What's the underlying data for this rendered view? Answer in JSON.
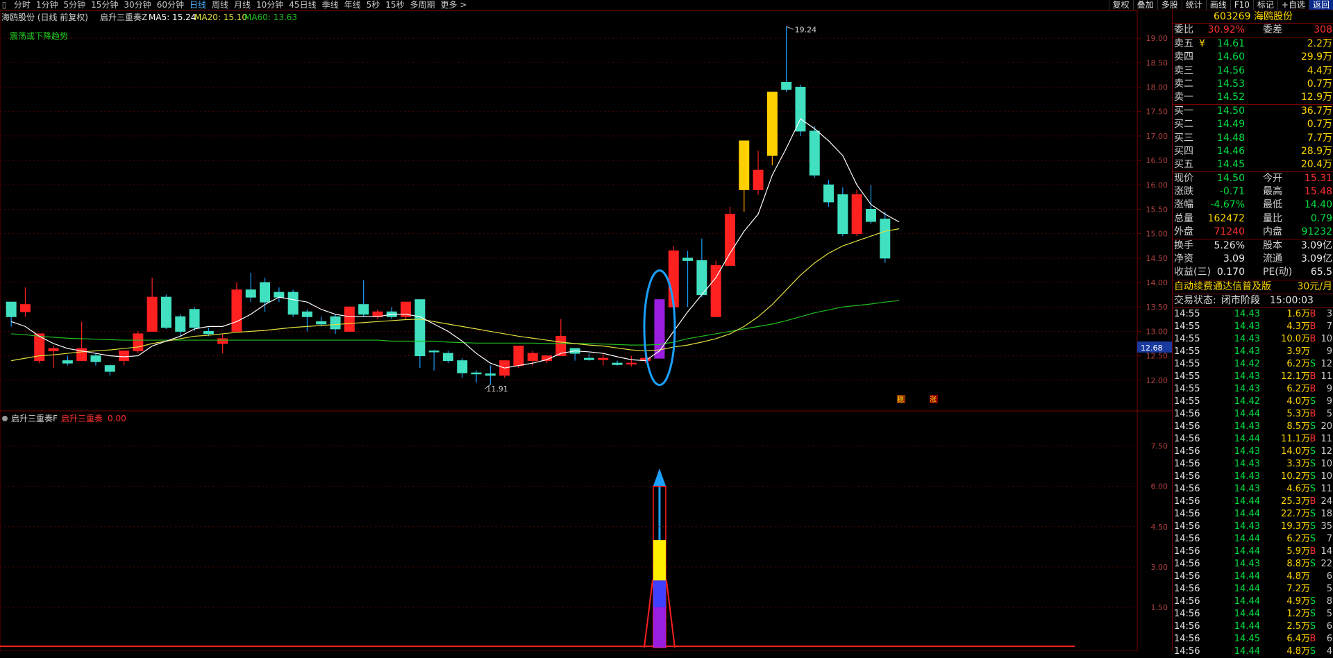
{
  "toolbar": {
    "menu_glyph": "▯",
    "tabs": [
      "分时",
      "1分钟",
      "5分钟",
      "15分钟",
      "30分钟",
      "60分钟",
      "日线",
      "周线",
      "月线",
      "10分钟",
      "45日线",
      "季线",
      "年线",
      "5秒",
      "15秒",
      "多周期",
      "更多 >"
    ],
    "active_tab": "日线",
    "right_buttons": [
      "复权",
      "叠加",
      "多股",
      "统计",
      "画线",
      "F10",
      "标记",
      "+自选",
      "返回"
    ]
  },
  "main_chart": {
    "title": "海鸥股份 (日线 前复权)",
    "indicator_name": "启升三重奏Z",
    "ma5_label": "MA5: 15.24",
    "ma20_label": "MA20: 15.10",
    "ma60_label": "MA60: 13.63",
    "note": "震荡或下降趋势",
    "high_label": "19.24",
    "low_label": "11.91",
    "current_price_tag": "12.68",
    "marker_1": "稳",
    "marker_2": "涨",
    "colors": {
      "up": "#ff2020",
      "down": "#40e0c0",
      "ma5": "#ffffff",
      "ma20": "#e0e040",
      "ma60": "#20c020",
      "highlight": "#9a1ee0",
      "ellipse": "#1aa0ff"
    }
  },
  "sub_chart": {
    "indicator_name": "启升三重奏F",
    "series_label": "启升三重奏",
    "series_value": "0.00"
  },
  "chart_data": {
    "type": "candlestick",
    "y_axis_ticks": [
      "12.00",
      "12.50",
      "13.00",
      "13.50",
      "14.00",
      "14.50",
      "15.00",
      "15.50",
      "16.00",
      "16.50",
      "17.00",
      "17.50",
      "18.00",
      "18.50",
      "19.00"
    ],
    "ylim": [
      11.4,
      19.5
    ],
    "sub_y_ticks": [
      "1.50",
      "3.00",
      "4.50",
      "6.00",
      "7.50"
    ],
    "sub_ylim": [
      0,
      8.6
    ],
    "candles": [
      [
        13.6,
        13.3,
        13.6,
        13.1
      ],
      [
        13.4,
        13.55,
        13.9,
        13.3
      ],
      [
        12.4,
        12.95,
        12.95,
        12.35
      ],
      [
        12.6,
        12.65,
        12.7,
        12.25
      ],
      [
        12.4,
        12.35,
        12.5,
        12.3
      ],
      [
        12.4,
        12.65,
        13.2,
        12.4
      ],
      [
        12.5,
        12.38,
        12.55,
        12.3
      ],
      [
        12.3,
        12.18,
        12.32,
        12.1
      ],
      [
        12.4,
        12.6,
        12.6,
        12.3
      ],
      [
        12.6,
        12.95,
        13.0,
        12.55
      ],
      [
        13.0,
        13.7,
        14.1,
        13.0
      ],
      [
        13.7,
        13.08,
        13.75,
        13.05
      ],
      [
        13.3,
        13.0,
        13.35,
        12.9
      ],
      [
        13.45,
        13.08,
        13.5,
        13.0
      ],
      [
        13.0,
        12.95,
        13.08,
        12.9
      ],
      [
        12.75,
        12.85,
        12.95,
        12.55
      ],
      [
        13.0,
        13.85,
        14.0,
        13.0
      ],
      [
        13.85,
        13.7,
        14.2,
        13.6
      ],
      [
        14.0,
        13.6,
        14.1,
        13.4
      ],
      [
        13.8,
        13.7,
        13.9,
        13.6
      ],
      [
        13.8,
        13.35,
        13.85,
        13.3
      ],
      [
        13.4,
        13.3,
        13.45,
        13.0
      ],
      [
        13.2,
        13.15,
        13.3,
        13.1
      ],
      [
        13.3,
        13.05,
        13.35,
        12.95
      ],
      [
        13.0,
        13.5,
        13.5,
        13.0
      ],
      [
        13.55,
        13.35,
        14.05,
        13.3
      ],
      [
        13.3,
        13.4,
        13.45,
        13.25
      ],
      [
        13.4,
        13.3,
        13.5,
        13.25
      ],
      [
        13.3,
        13.6,
        13.6,
        13.25
      ],
      [
        13.65,
        12.5,
        13.65,
        12.25
      ],
      [
        12.6,
        12.58,
        12.62,
        12.2
      ],
      [
        12.55,
        12.4,
        12.6,
        12.35
      ],
      [
        12.4,
        12.15,
        12.45,
        12.05
      ],
      [
        12.15,
        12.13,
        12.2,
        11.95
      ],
      [
        12.13,
        12.1,
        12.3,
        11.91
      ],
      [
        12.1,
        12.4,
        12.4,
        12.05
      ],
      [
        12.3,
        12.7,
        12.7,
        12.25
      ],
      [
        12.4,
        12.55,
        12.6,
        12.3
      ],
      [
        12.4,
        12.5,
        12.5,
        12.35
      ],
      [
        12.5,
        12.9,
        13.25,
        12.5
      ],
      [
        12.65,
        12.55,
        12.65,
        12.4
      ],
      [
        12.45,
        12.42,
        12.55,
        12.4
      ],
      [
        12.42,
        12.45,
        12.55,
        12.3
      ],
      [
        12.35,
        12.32,
        12.4,
        12.3
      ],
      [
        12.33,
        12.35,
        12.5,
        12.28
      ],
      [
        12.4,
        12.45,
        12.5,
        12.35
      ],
      [
        12.45,
        13.65,
        13.65,
        12.45
      ],
      [
        13.5,
        14.65,
        14.75,
        13.45
      ],
      [
        14.5,
        14.45,
        14.65,
        13.5
      ],
      [
        14.45,
        13.75,
        14.9,
        13.7
      ],
      [
        13.3,
        14.35,
        14.45,
        13.3
      ],
      [
        14.35,
        15.4,
        15.55,
        14.35
      ],
      [
        15.9,
        16.9,
        16.9,
        15.45
      ],
      [
        15.9,
        16.3,
        16.7,
        15.8
      ],
      [
        16.6,
        17.9,
        17.9,
        16.4
      ],
      [
        18.1,
        17.95,
        19.24,
        17.9
      ],
      [
        18.0,
        17.1,
        18.05,
        17.0
      ],
      [
        17.1,
        16.2,
        17.2,
        16.15
      ],
      [
        16.0,
        15.65,
        16.1,
        15.55
      ],
      [
        15.8,
        15.0,
        15.95,
        14.95
      ],
      [
        15.0,
        15.8,
        15.9,
        14.95
      ],
      [
        15.5,
        15.25,
        16.0,
        15.2
      ],
      [
        15.3,
        14.5,
        15.45,
        14.4
      ]
    ],
    "ma5": [
      13.2,
      13.1,
      12.9,
      12.75,
      12.65,
      12.6,
      12.55,
      12.5,
      12.48,
      12.5,
      12.7,
      12.8,
      12.9,
      13.05,
      13.1,
      13.1,
      13.2,
      13.35,
      13.55,
      13.7,
      13.65,
      13.6,
      13.45,
      13.35,
      13.3,
      13.3,
      13.3,
      13.35,
      13.35,
      13.3,
      13.15,
      13.0,
      12.8,
      12.55,
      12.35,
      12.25,
      12.3,
      12.35,
      12.42,
      12.55,
      12.6,
      12.58,
      12.55,
      12.48,
      12.42,
      12.4,
      12.6,
      13.0,
      13.4,
      13.75,
      14.1,
      14.6,
      15.05,
      15.4,
      16.2,
      16.75,
      17.35,
      17.15,
      16.9,
      16.6,
      16.0,
      15.6,
      15.4,
      15.24
    ],
    "ma20": [
      12.4,
      12.45,
      12.5,
      12.52,
      12.55,
      12.58,
      12.6,
      12.62,
      12.65,
      12.68,
      12.75,
      12.8,
      12.85,
      12.9,
      12.92,
      12.95,
      12.98,
      13.0,
      13.02,
      13.05,
      13.08,
      13.1,
      13.12,
      13.14,
      13.16,
      13.18,
      13.2,
      13.22,
      13.24,
      13.25,
      13.2,
      13.15,
      13.1,
      13.05,
      13.0,
      12.95,
      12.9,
      12.86,
      12.82,
      12.78,
      12.75,
      12.72,
      12.7,
      12.66,
      12.62,
      12.6,
      12.62,
      12.68,
      12.72,
      12.78,
      12.85,
      12.95,
      13.1,
      13.3,
      13.55,
      13.85,
      14.15,
      14.4,
      14.6,
      14.75,
      14.85,
      14.95,
      15.05,
      15.1
    ],
    "ma60": [
      12.95,
      12.93,
      12.9,
      12.88,
      12.86,
      12.85,
      12.84,
      12.83,
      12.82,
      12.82,
      12.82,
      12.82,
      12.82,
      12.82,
      12.82,
      12.82,
      12.82,
      12.82,
      12.82,
      12.82,
      12.82,
      12.82,
      12.82,
      12.82,
      12.82,
      12.82,
      12.82,
      12.8,
      12.8,
      12.8,
      12.8,
      12.78,
      12.77,
      12.76,
      12.76,
      12.76,
      12.76,
      12.76,
      12.75,
      12.75,
      12.75,
      12.75,
      12.74,
      12.73,
      12.72,
      12.72,
      12.73,
      12.78,
      12.85,
      12.9,
      12.95,
      13.0,
      13.05,
      13.1,
      13.15,
      13.22,
      13.3,
      13.38,
      13.44,
      13.5,
      13.53,
      13.56,
      13.6,
      13.63
    ],
    "highlight_index": 46,
    "sub_bar": {
      "index": 46,
      "total": 6.0,
      "segments": [
        {
          "color": "#9a1ee0",
          "value": 1.5
        },
        {
          "color": "#4040ff",
          "value": 1.0
        },
        {
          "color": "#ffee00",
          "value": 1.5
        }
      ]
    }
  },
  "quote": {
    "code": "603269",
    "name": "海鸥股份",
    "weibi_label": "委比",
    "weibi_value": "30.92%",
    "weicha_label": "委差",
    "weicha_value": "308",
    "sells": [
      {
        "label": "卖五",
        "flag": "¥",
        "price": "14.61",
        "vol": "2.2万"
      },
      {
        "label": "卖四",
        "flag": "",
        "price": "14.60",
        "vol": "29.9万"
      },
      {
        "label": "卖三",
        "flag": "",
        "price": "14.56",
        "vol": "4.4万"
      },
      {
        "label": "卖二",
        "flag": "",
        "price": "14.53",
        "vol": "0.7万"
      },
      {
        "label": "卖一",
        "flag": "",
        "price": "14.52",
        "vol": "12.9万"
      }
    ],
    "buys": [
      {
        "label": "买一",
        "price": "14.50",
        "vol": "36.7万"
      },
      {
        "label": "买二",
        "price": "14.49",
        "vol": "0.7万"
      },
      {
        "label": "买三",
        "price": "14.48",
        "vol": "7.7万"
      },
      {
        "label": "买四",
        "price": "14.46",
        "vol": "28.9万"
      },
      {
        "label": "买五",
        "price": "14.45",
        "vol": "20.4万"
      }
    ],
    "stats": [
      {
        "l1": "现价",
        "v1": "14.50",
        "c1": "green",
        "l2": "今开",
        "v2": "15.31",
        "c2": "red"
      },
      {
        "l1": "涨跌",
        "v1": "-0.71",
        "c1": "green",
        "l2": "最高",
        "v2": "15.48",
        "c2": "red"
      },
      {
        "l1": "涨幅",
        "v1": "-4.67%",
        "c1": "green",
        "l2": "最低",
        "v2": "14.40",
        "c2": "green"
      },
      {
        "l1": "总量",
        "v1": "162472",
        "c1": "yellow",
        "l2": "量比",
        "v2": "0.79",
        "c2": "green"
      },
      {
        "l1": "外盘",
        "v1": "71240",
        "c1": "red",
        "l2": "内盘",
        "v2": "91232",
        "c2": "green"
      }
    ],
    "fund": [
      {
        "l1": "换手",
        "v1": "5.26%",
        "l2": "股本",
        "v2": "3.09亿"
      },
      {
        "l1": "净资",
        "v1": "3.09",
        "l2": "流通",
        "v2": "3.09亿"
      },
      {
        "l1": "收益(三)",
        "v1": "0.170",
        "l2": "PE(动)",
        "v2": "65.5"
      }
    ],
    "promo": "自动续费通达信普及版",
    "promo_price": "30元/月",
    "status_label": "交易状态:",
    "status_value": "闭市阶段",
    "status_time": "15:00:03",
    "ticks": [
      {
        "t": "14:55",
        "p": "14.43",
        "v": "1.6万",
        "bs": "B",
        "n": "3"
      },
      {
        "t": "14:55",
        "p": "14.43",
        "v": "4.3万",
        "bs": "B",
        "n": "7"
      },
      {
        "t": "14:55",
        "p": "14.43",
        "v": "10.0万",
        "bs": "B",
        "n": "10"
      },
      {
        "t": "14:55",
        "p": "14.43",
        "v": "3.9万",
        "bs": "",
        "n": "9"
      },
      {
        "t": "14:55",
        "p": "14.42",
        "v": "6.2万",
        "bs": "S",
        "n": "12"
      },
      {
        "t": "14:55",
        "p": "14.43",
        "v": "12.1万",
        "bs": "B",
        "n": "11"
      },
      {
        "t": "14:55",
        "p": "14.43",
        "v": "6.2万",
        "bs": "B",
        "n": "9"
      },
      {
        "t": "14:55",
        "p": "14.42",
        "v": "4.0万",
        "bs": "S",
        "n": "9"
      },
      {
        "t": "14:56",
        "p": "14.44",
        "v": "5.3万",
        "bs": "B",
        "n": "5"
      },
      {
        "t": "14:56",
        "p": "14.43",
        "v": "8.5万",
        "bs": "S",
        "n": "20"
      },
      {
        "t": "14:56",
        "p": "14.44",
        "v": "11.1万",
        "bs": "B",
        "n": "11"
      },
      {
        "t": "14:56",
        "p": "14.43",
        "v": "14.0万",
        "bs": "S",
        "n": "12"
      },
      {
        "t": "14:56",
        "p": "14.43",
        "v": "3.3万",
        "bs": "S",
        "n": "10"
      },
      {
        "t": "14:56",
        "p": "14.43",
        "v": "10.2万",
        "bs": "S",
        "n": "10"
      },
      {
        "t": "14:56",
        "p": "14.43",
        "v": "4.6万",
        "bs": "S",
        "n": "11"
      },
      {
        "t": "14:56",
        "p": "14.44",
        "v": "25.3万",
        "bs": "B",
        "n": "24"
      },
      {
        "t": "14:56",
        "p": "14.44",
        "v": "22.7万",
        "bs": "S",
        "n": "18"
      },
      {
        "t": "14:56",
        "p": "14.43",
        "v": "19.3万",
        "bs": "S",
        "n": "35"
      },
      {
        "t": "14:56",
        "p": "14.44",
        "v": "6.2万",
        "bs": "S",
        "n": "7"
      },
      {
        "t": "14:56",
        "p": "14.44",
        "v": "5.9万",
        "bs": "B",
        "n": "14"
      },
      {
        "t": "14:56",
        "p": "14.43",
        "v": "8.8万",
        "bs": "S",
        "n": "22"
      },
      {
        "t": "14:56",
        "p": "14.44",
        "v": "4.8万",
        "bs": "",
        "n": "6"
      },
      {
        "t": "14:56",
        "p": "14.44",
        "v": "7.2万",
        "bs": "",
        "n": "5"
      },
      {
        "t": "14:56",
        "p": "14.44",
        "v": "4.9万",
        "bs": "S",
        "n": "8"
      },
      {
        "t": "14:56",
        "p": "14.44",
        "v": "1.2万",
        "bs": "S",
        "n": "5"
      },
      {
        "t": "14:56",
        "p": "14.44",
        "v": "2.5万",
        "bs": "S",
        "n": "6"
      },
      {
        "t": "14:56",
        "p": "14.45",
        "v": "6.4万",
        "bs": "B",
        "n": "6"
      },
      {
        "t": "14:56",
        "p": "14.44",
        "v": "4.8万",
        "bs": "S",
        "n": "4"
      }
    ]
  }
}
